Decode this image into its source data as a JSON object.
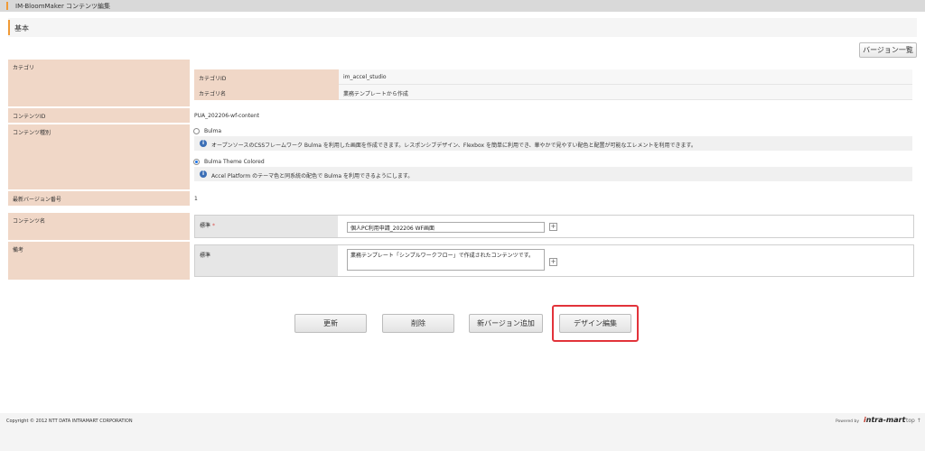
{
  "app": {
    "title": "IM-BloomMaker コンテンツ編集"
  },
  "section": {
    "title": "基本"
  },
  "toolbar": {
    "version_list": "バージョン一覧"
  },
  "category": {
    "label": "カテゴリ",
    "id_label": "カテゴリID",
    "id_value": "im_accel_studio",
    "name_label": "カテゴリ名",
    "name_value": "業務テンプレートから作成"
  },
  "content_id": {
    "label": "コンテンツID",
    "value": "PUA_202206-wf-content"
  },
  "content_type": {
    "label": "コンテンツ種別",
    "options": [
      {
        "label": "Bulma",
        "selected": false,
        "description": "オープンソースのCSSフレームワーク Bulma を利用した画面を作成できます。レスポンシブデザイン、Flexbox を簡単に利用でき、華やかで見やすい配色と配置が可能なエレメントを利用できます。"
      },
      {
        "label": "Bulma Theme Colored",
        "selected": true,
        "description": "Accel Platform のテーマ色と同系統の配色で Bulma を利用できるようにします。"
      }
    ]
  },
  "latest_version": {
    "label": "最新バージョン番号",
    "value": "1"
  },
  "content_name": {
    "label": "コンテンツ名",
    "locale_label": "標準",
    "required_mark": "*",
    "value": "個人PC利用申請_202206 WF画面"
  },
  "remarks": {
    "label": "備考",
    "locale_label": "標準",
    "value": "業務テンプレート「シンプルワークフロー」で作成されたコンテンツです。"
  },
  "actions": {
    "update": "更新",
    "delete": "削除",
    "add_version": "新バージョン追加",
    "design_edit": "デザイン編集"
  },
  "footer": {
    "copyright": "Copyright © 2012 NTT DATA INTRAMART CORPORATION",
    "powered_by": "Powered by",
    "logo_prefix": "i",
    "logo_text": "ntra-mart",
    "top_link": "top ↑"
  },
  "icons": {
    "info": "info-icon",
    "plus": "plus-icon",
    "section_marker": "section-marker-icon"
  },
  "colors": {
    "accent": "#f09a36",
    "header_cell": "#f0d7c7",
    "highlight": "#e2333a",
    "radio_selected": "#1a73e8"
  }
}
